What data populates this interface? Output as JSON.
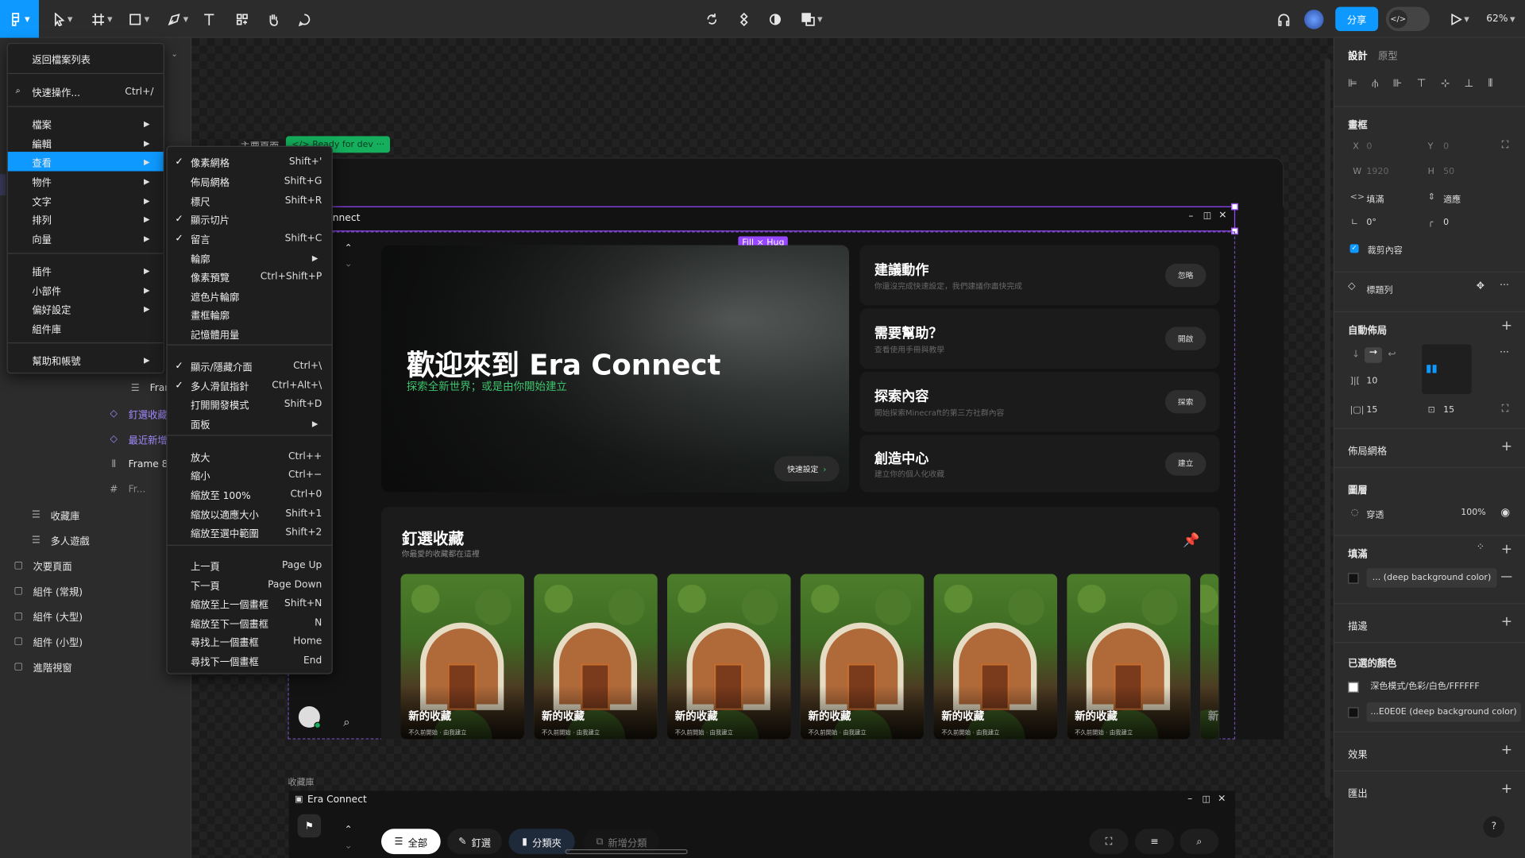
{
  "toolbar": {
    "share": "分享",
    "zoom": "62%"
  },
  "main_menu": {
    "items": [
      {
        "label": "返回檔案列表"
      },
      {
        "label": "快速操作...",
        "shortcut": "Ctrl+/"
      },
      {
        "label": "檔案"
      },
      {
        "label": "編輯"
      },
      {
        "label": "查看"
      },
      {
        "label": "物件"
      },
      {
        "label": "文字"
      },
      {
        "label": "排列"
      },
      {
        "label": "向量"
      },
      {
        "label": "插件"
      },
      {
        "label": "小部件"
      },
      {
        "label": "偏好設定"
      },
      {
        "label": "組件庫"
      },
      {
        "label": "幫助和帳號"
      }
    ]
  },
  "view_menu": {
    "items": [
      {
        "label": "像素網格",
        "shortcut": "Shift+'",
        "checked": true
      },
      {
        "label": "佈局網格",
        "shortcut": "Shift+G"
      },
      {
        "label": "標尺",
        "shortcut": "Shift+R"
      },
      {
        "label": "顯示切片",
        "shortcut": "",
        "checked": true
      },
      {
        "label": "留言",
        "shortcut": "Shift+C",
        "checked": true
      },
      {
        "label": "輪廓",
        "shortcut": ""
      },
      {
        "label": "像素預覽",
        "shortcut": "Ctrl+Shift+P"
      },
      {
        "label": "遮色片輪廓",
        "shortcut": ""
      },
      {
        "label": "畫框輪廓",
        "shortcut": ""
      },
      {
        "label": "記憶體用量",
        "shortcut": ""
      },
      {
        "label": "顯示/隱藏介面",
        "shortcut": "Ctrl+\\",
        "checked": true
      },
      {
        "label": "多人滑鼠指針",
        "shortcut": "Ctrl+Alt+\\",
        "checked": true
      },
      {
        "label": "打開開發模式",
        "shortcut": "Shift+D"
      },
      {
        "label": "面板",
        "shortcut": ""
      },
      {
        "label": "放大",
        "shortcut": "Ctrl++"
      },
      {
        "label": "縮小",
        "shortcut": "Ctrl+−"
      },
      {
        "label": "縮放至 100%",
        "shortcut": "Ctrl+0"
      },
      {
        "label": "縮放以適應大小",
        "shortcut": "Shift+1"
      },
      {
        "label": "縮放至選中範圍",
        "shortcut": "Shift+2"
      },
      {
        "label": "上一頁",
        "shortcut": "Page Up"
      },
      {
        "label": "下一頁",
        "shortcut": "Page Down"
      },
      {
        "label": "縮放至上一個畫框",
        "shortcut": "Shift+N"
      },
      {
        "label": "縮放至下一個畫框",
        "shortcut": "N"
      },
      {
        "label": "尋找上一個畫框",
        "shortcut": "Home"
      },
      {
        "label": "尋找下一個畫框",
        "shortcut": "End"
      }
    ]
  },
  "layers": {
    "items": [
      {
        "label": "Fram"
      },
      {
        "label": "釘選收藏"
      },
      {
        "label": "最近新增"
      },
      {
        "label": "Frame 82"
      },
      {
        "label": "Fr..."
      },
      {
        "label": "收藏庫"
      },
      {
        "label": "多人遊戲"
      },
      {
        "label": "次要頁面"
      },
      {
        "label": "組件 (常規)"
      },
      {
        "label": "組件 (大型)"
      },
      {
        "label": "組件 (小型)"
      },
      {
        "label": "進階視窗"
      }
    ]
  },
  "canvas": {
    "frame_label": "主要頁面",
    "dev_badge": "Ready for dev",
    "fill_hug": "Fill × Hug",
    "app_title": "nnect",
    "hero": {
      "title": "歡迎來到 Era Connect",
      "subtitle": "探索全新世界；或是由你開始建立",
      "quick_button": "快速設定"
    },
    "actions": [
      {
        "title": "建議動作",
        "desc": "你還沒完成快速設定，我們建議你盡快完成",
        "button": "忽略"
      },
      {
        "title": "需要幫助？",
        "desc": "查看使用手冊與教學",
        "button": "開啟"
      },
      {
        "title": "探索內容",
        "desc": "開始探索Minecraft的第三方社群內容",
        "button": "探索"
      },
      {
        "title": "創造中心",
        "desc": "建立你的個人化收藏",
        "button": "建立"
      }
    ],
    "pinned": {
      "title": "釘選收藏",
      "subtitle": "你最愛的收藏都在這裡",
      "cards": [
        {
          "title": "新的收藏",
          "desc": "不久前開始 · 由我建立"
        },
        {
          "title": "新的收藏",
          "desc": "不久前開始 · 由我建立"
        },
        {
          "title": "新的收藏",
          "desc": "不久前開始 · 由我建立"
        },
        {
          "title": "新的收藏",
          "desc": "不久前開始 · 由我建立"
        },
        {
          "title": "新的收藏",
          "desc": "不久前開始 · 由我建立"
        },
        {
          "title": "新的收藏",
          "desc": "不久前開始 · 由我建立"
        },
        {
          "title": "新"
        }
      ]
    },
    "second_frame_label": "收藏庫",
    "second_app_title": "Era Connect",
    "tabs": [
      {
        "label": "全部"
      },
      {
        "label": "釘選"
      },
      {
        "label": "分類夾"
      },
      {
        "label": "新增分類"
      }
    ]
  },
  "design_panel": {
    "tabs": [
      "設計",
      "原型"
    ],
    "frame_section": "畫框",
    "x": {
      "label": "X",
      "value": "0"
    },
    "y": {
      "label": "Y",
      "value": "0"
    },
    "w": {
      "label": "W",
      "value": "1920"
    },
    "h": {
      "label": "H",
      "value": "50"
    },
    "fill_mode": "填滿",
    "hug_mode": "適應",
    "rotation": "0°",
    "radius": "0",
    "clip": "裁剪內容",
    "component": "標題列",
    "auto_layout": "自動佈局",
    "gap": "10",
    "pad_h": "15",
    "pad_v": "15",
    "layout_grid": "佈局網格",
    "layer": "圖層",
    "blend": "穿透",
    "opacity": "100%",
    "fill": "填滿",
    "fill_value": "... (deep background color)",
    "stroke": "描邊",
    "selected_colors": "已選的顏色",
    "color1": "深色模式/色彩/白色/FFFFFF",
    "color2": "...E0E0E (deep background color)",
    "effects": "效果",
    "export": "匯出",
    "help": "?"
  },
  "colors": {
    "accent": "#0d99ff",
    "green": "#14ae5c",
    "purple": "#9747ff",
    "subtitle_green": "#3ec46d"
  }
}
